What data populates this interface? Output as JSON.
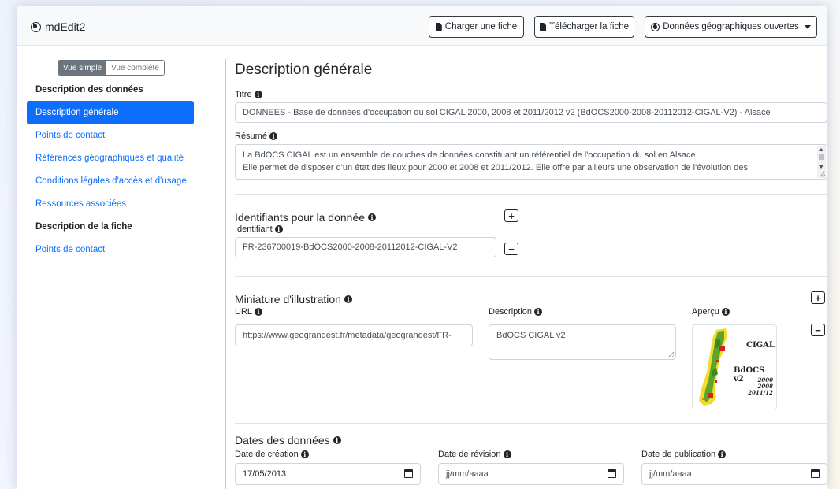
{
  "app": {
    "title": "mdEdit2"
  },
  "navbar": {
    "load_label": "Charger une fiche",
    "download_label": "Télécharger la fiche",
    "profile_label": "Données géographiques ouvertes"
  },
  "sidebar": {
    "view_simple": "Vue simple",
    "view_full": "Vue complète",
    "items": [
      {
        "label": "Description des données"
      },
      {
        "label": "Description générale"
      },
      {
        "label": "Points de contact"
      },
      {
        "label": "Références géographiques et qualité"
      },
      {
        "label": "Conditions légales d'accès et d'usage"
      },
      {
        "label": "Ressources associées"
      },
      {
        "label": "Description de la fiche"
      },
      {
        "label": "Points de contact"
      }
    ]
  },
  "main": {
    "heading": "Description générale",
    "titre_label": "Titre",
    "titre_value": "DONNEES - Base de données d'occupation du sol CIGAL 2000, 2008 et 2011/2012 v2 (BdOCS2000-2008-20112012-CIGAL-V2) - Alsace",
    "resume_label": "Résumé",
    "resume_line1": "La BdOCS CIGAL est un ensemble de couches de données constituant un référentiel de l'occupation du sol en Alsace.",
    "resume_line2": "Elle permet de disposer d'un état des lieux pour 2000 et 2008 et 2011/2012. Elle offre par ailleurs une observation de l'évolution des",
    "identifiants": {
      "title": "Identifiants pour la donnée",
      "label": "Identifiant",
      "value": "FR-236700019-BdOCS2000-2008-20112012-CIGAL-V2"
    },
    "miniature": {
      "title": "Miniature d'illustration",
      "url_label": "URL",
      "url_value": "https://www.geograndest.fr/metadata/geograndest/FR-",
      "desc_label": "Description",
      "desc_value": "BdOCS CIGAL v2",
      "apercu_label": "Aperçu",
      "preview_title": "CIGAL",
      "preview_subtitle": "BdOCS v2",
      "preview_y1": "2000",
      "preview_y2": "2008",
      "preview_y3": "2011/12"
    },
    "dates": {
      "title": "Dates des données",
      "creation_label": "Date de création",
      "creation_value": "17/05/2013",
      "revision_label": "Date de révision",
      "revision_value": "jj/mm/aaaa",
      "publication_label": "Date de publication",
      "publication_value": "jj/mm/aaaa"
    }
  }
}
